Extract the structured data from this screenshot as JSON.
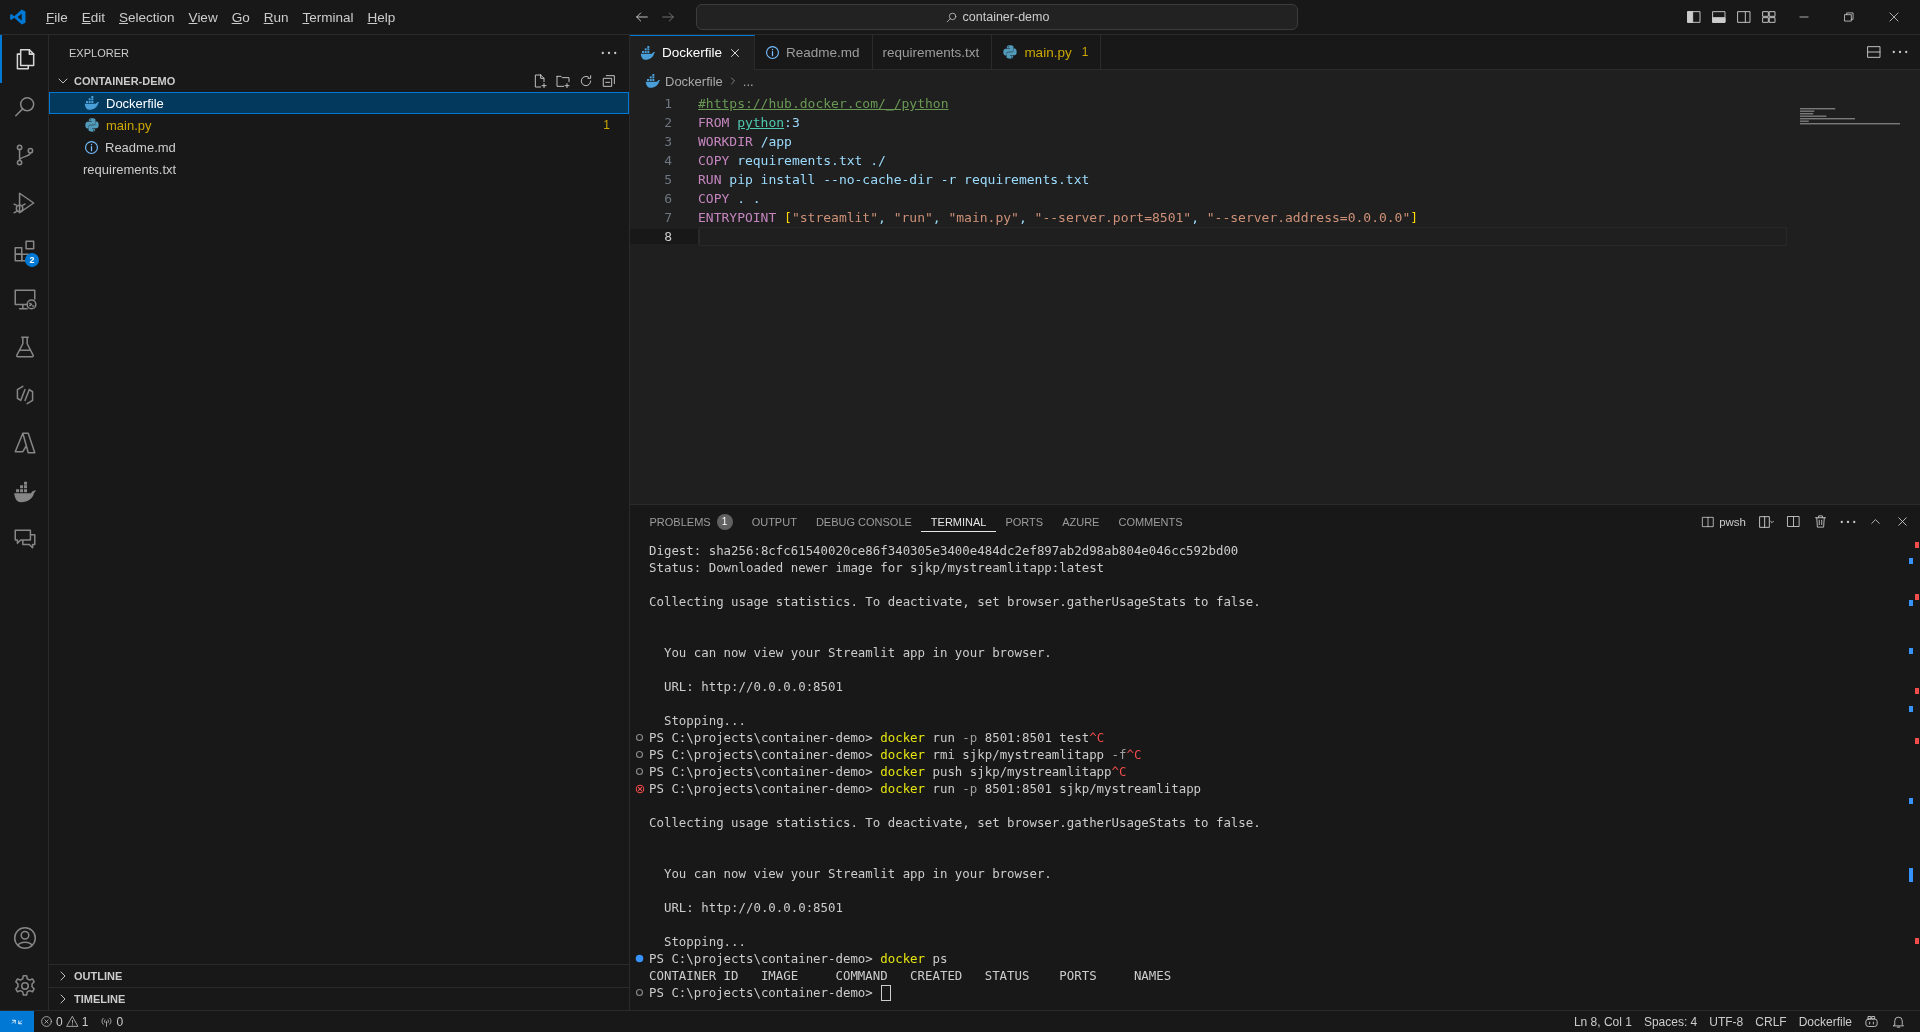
{
  "title_bar": {
    "menu": [
      "File",
      "Edit",
      "Selection",
      "View",
      "Go",
      "Run",
      "Terminal",
      "Help"
    ],
    "search": "container-demo"
  },
  "activity_bar": {
    "items": [
      {
        "kind": "files",
        "selected": true
      },
      {
        "kind": "search",
        "selected": false
      },
      {
        "kind": "source-control",
        "selected": false
      },
      {
        "kind": "run-debug",
        "selected": false
      },
      {
        "kind": "extensions",
        "selected": false,
        "badge": "2"
      },
      {
        "kind": "remote",
        "selected": false
      },
      {
        "kind": "testing",
        "selected": false
      },
      {
        "kind": "links",
        "selected": false
      },
      {
        "kind": "azure",
        "selected": false
      },
      {
        "kind": "docker",
        "selected": false
      },
      {
        "kind": "chat",
        "selected": false
      }
    ],
    "bottom_items": [
      {
        "kind": "account"
      },
      {
        "kind": "settings"
      }
    ]
  },
  "sidebar": {
    "title": "EXPLORER",
    "folder": "CONTAINER-DEMO",
    "expanded": true,
    "files": [
      {
        "name": "Dockerfile",
        "kind": "docker",
        "selected": true,
        "warning": false
      },
      {
        "name": "main.py",
        "kind": "python",
        "selected": false,
        "warning": true,
        "problems": "1"
      },
      {
        "name": "Readme.md",
        "kind": "info",
        "selected": false,
        "warning": false
      },
      {
        "name": "requirements.txt",
        "kind": "none",
        "selected": false,
        "warning": false
      }
    ],
    "sections": [
      {
        "label": "OUTLINE",
        "expanded": false
      },
      {
        "label": "TIMELINE",
        "expanded": false
      }
    ]
  },
  "editor": {
    "tabs": [
      {
        "label": "Dockerfile",
        "kind": "docker",
        "selected": true,
        "warning": false
      },
      {
        "label": "Readme.md",
        "kind": "info",
        "selected": false,
        "warning": false
      },
      {
        "label": "requirements.txt",
        "kind": "none",
        "selected": false,
        "warning": false
      },
      {
        "label": "main.py",
        "kind": "python",
        "selected": false,
        "warning": true,
        "problems": "1"
      }
    ],
    "breadcrumb": [
      "Dockerfile",
      "..."
    ],
    "lines": [
      {
        "number": "1",
        "active": false,
        "tokens": [
          {
            "text": "#https://hub.docker.com/_/python",
            "kind": "link"
          }
        ]
      },
      {
        "number": "2",
        "active": false,
        "tokens": [
          {
            "text": "FROM ",
            "kind": "keyword"
          },
          {
            "text": "python",
            "kind": "image"
          },
          {
            "text": ":3",
            "kind": "text"
          }
        ]
      },
      {
        "number": "3",
        "active": false,
        "tokens": [
          {
            "text": "WORKDIR ",
            "kind": "keyword"
          },
          {
            "text": "/app",
            "kind": "text"
          }
        ]
      },
      {
        "number": "4",
        "active": false,
        "tokens": [
          {
            "text": "COPY ",
            "kind": "keyword"
          },
          {
            "text": "requirements.txt ./",
            "kind": "text"
          }
        ]
      },
      {
        "number": "5",
        "active": false,
        "tokens": [
          {
            "text": "RUN ",
            "kind": "keyword"
          },
          {
            "text": "pip install --no-cache-dir -r requirements.txt",
            "kind": "text"
          }
        ]
      },
      {
        "number": "6",
        "active": false,
        "tokens": [
          {
            "text": "COPY ",
            "kind": "keyword"
          },
          {
            "text": ". .",
            "kind": "text"
          }
        ]
      },
      {
        "number": "7",
        "active": false,
        "tokens": [
          {
            "text": "ENTRYPOINT ",
            "kind": "keyword"
          },
          {
            "text": "[",
            "kind": "bracket"
          },
          {
            "text": "\"streamlit\"",
            "kind": "string"
          },
          {
            "text": ", ",
            "kind": "text"
          },
          {
            "text": "\"run\"",
            "kind": "string"
          },
          {
            "text": ", ",
            "kind": "text"
          },
          {
            "text": "\"main.py\"",
            "kind": "string"
          },
          {
            "text": ", ",
            "kind": "text"
          },
          {
            "text": "\"--server.port=8501\"",
            "kind": "string"
          },
          {
            "text": ", ",
            "kind": "text"
          },
          {
            "text": "\"--server.address=0.0.0.0\"",
            "kind": "string"
          },
          {
            "text": "]",
            "kind": "bracket"
          }
        ]
      },
      {
        "number": "8",
        "active": true
      }
    ]
  },
  "panel": {
    "tabs": [
      {
        "label": "PROBLEMS",
        "selected": false,
        "badge": "1"
      },
      {
        "label": "OUTPUT",
        "selected": false
      },
      {
        "label": "DEBUG CONSOLE",
        "selected": false
      },
      {
        "label": "TERMINAL",
        "selected": true
      },
      {
        "label": "PORTS",
        "selected": false
      },
      {
        "label": "AZURE",
        "selected": false
      },
      {
        "label": "COMMENTS",
        "selected": false
      }
    ],
    "shell": "pwsh",
    "terminal": [
      {
        "kind": "output",
        "tokens": [
          {
            "text": "Digest: sha256:8cfc61540020ce86f340305e3400e484dc2ef897ab2d98ab804e046cc592bd00",
            "kind": "text"
          }
        ]
      },
      {
        "kind": "output",
        "tokens": [
          {
            "text": "Status: Downloaded newer image for sjkp/mystreamlitapp:latest",
            "kind": "text"
          }
        ]
      },
      {
        "kind": "blank"
      },
      {
        "kind": "output",
        "tokens": [
          {
            "text": "Collecting usage statistics. To deactivate, set browser.gatherUsageStats to false.",
            "kind": "text"
          }
        ]
      },
      {
        "kind": "blank"
      },
      {
        "kind": "blank"
      },
      {
        "kind": "output",
        "tokens": [
          {
            "text": "  You can now view your Streamlit app in your browser.",
            "kind": "text"
          }
        ]
      },
      {
        "kind": "blank"
      },
      {
        "kind": "output",
        "tokens": [
          {
            "text": "  URL: http://0.0.0.0:8501",
            "kind": "text"
          }
        ]
      },
      {
        "kind": "blank"
      },
      {
        "kind": "output",
        "tokens": [
          {
            "text": "  Stopping...",
            "kind": "text"
          }
        ]
      },
      {
        "kind": "command",
        "succeeded": false,
        "failed": false,
        "tokens": [
          {
            "text": "PS C:\\projects\\container-demo> ",
            "kind": "text"
          },
          {
            "text": "docker",
            "kind": "command"
          },
          {
            "text": " run ",
            "kind": "text"
          },
          {
            "text": "-p",
            "kind": "flag"
          },
          {
            "text": " 8501:8501 test",
            "kind": "text"
          },
          {
            "text": "^C",
            "kind": "ctrl"
          }
        ]
      },
      {
        "kind": "command",
        "succeeded": false,
        "failed": false,
        "tokens": [
          {
            "text": "PS C:\\projects\\container-demo> ",
            "kind": "text"
          },
          {
            "text": "docker",
            "kind": "command"
          },
          {
            "text": " rmi sjkp/mystreamlitapp ",
            "kind": "text"
          },
          {
            "text": "-f",
            "kind": "flag"
          },
          {
            "text": "^C",
            "kind": "ctrl"
          }
        ]
      },
      {
        "kind": "command",
        "succeeded": false,
        "failed": false,
        "tokens": [
          {
            "text": "PS C:\\projects\\container-demo> ",
            "kind": "text"
          },
          {
            "text": "docker",
            "kind": "command"
          },
          {
            "text": " push sjkp/mystreamlitapp",
            "kind": "text"
          },
          {
            "text": "^C",
            "kind": "ctrl"
          }
        ]
      },
      {
        "kind": "command",
        "succeeded": false,
        "failed": true,
        "tokens": [
          {
            "text": "PS C:\\projects\\container-demo> ",
            "kind": "text"
          },
          {
            "text": "docker",
            "kind": "command"
          },
          {
            "text": " run ",
            "kind": "text"
          },
          {
            "text": "-p",
            "kind": "flag"
          },
          {
            "text": " 8501:8501 sjkp/mystreamlitapp",
            "kind": "text"
          }
        ]
      },
      {
        "kind": "blank"
      },
      {
        "kind": "output",
        "tokens": [
          {
            "text": "Collecting usage statistics. To deactivate, set browser.gatherUsageStats to false.",
            "kind": "text"
          }
        ]
      },
      {
        "kind": "blank"
      },
      {
        "kind": "blank"
      },
      {
        "kind": "output",
        "tokens": [
          {
            "text": "  You can now view your Streamlit app in your browser.",
            "kind": "text"
          }
        ]
      },
      {
        "kind": "blank"
      },
      {
        "kind": "output",
        "tokens": [
          {
            "text": "  URL: http://0.0.0.0:8501",
            "kind": "text"
          }
        ]
      },
      {
        "kind": "blank"
      },
      {
        "kind": "output",
        "tokens": [
          {
            "text": "  Stopping...",
            "kind": "text"
          }
        ]
      },
      {
        "kind": "command",
        "succeeded": true,
        "failed": false,
        "tokens": [
          {
            "text": "PS C:\\projects\\container-demo> ",
            "kind": "text"
          },
          {
            "text": "docker",
            "kind": "command"
          },
          {
            "text": " ps",
            "kind": "text"
          }
        ]
      },
      {
        "kind": "output",
        "tokens": [
          {
            "text": "CONTAINER ID   IMAGE     COMMAND   CREATED   STATUS    PORTS     NAMES",
            "kind": "text"
          }
        ]
      },
      {
        "kind": "command",
        "succeeded": false,
        "failed": false,
        "cursor": true,
        "tokens": [
          {
            "text": "PS C:\\projects\\container-demo> ",
            "kind": "text"
          }
        ]
      }
    ]
  },
  "status_bar": {
    "errors": "0",
    "warnings": "1",
    "ports": "0",
    "right": [
      "Ln 8, Col 1",
      "Spaces: 4",
      "UTF-8",
      "CRLF",
      "Dockerfile"
    ]
  }
}
